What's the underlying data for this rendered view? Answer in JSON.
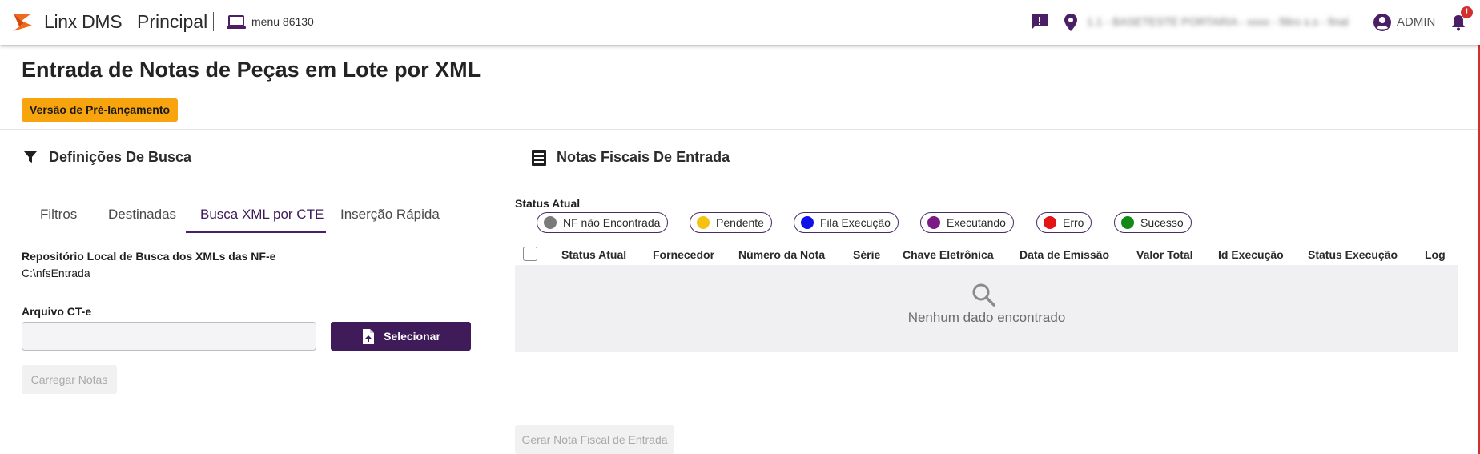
{
  "topbar": {
    "brand": "Linx DMS",
    "module": "Principal",
    "menu_label": "menu 86130",
    "location_text": "1.1 - BASETESTE PORTARIA - xxxx - filtro s.s - final",
    "user": "ADMIN",
    "notification_badge": "!",
    "colors": {
      "accent": "#4a1f66",
      "logo": "#f06a1e",
      "badge": "#d32f2f"
    }
  },
  "page": {
    "title": "Entrada de Notas de Peças em Lote por XML",
    "badge": "Versão de Pré-lançamento"
  },
  "left_panel": {
    "title": "Definições De Busca",
    "tabs": [
      {
        "label": "Filtros",
        "active": false
      },
      {
        "label": "Destinadas",
        "active": false
      },
      {
        "label": "Busca XML por CTE",
        "active": true
      },
      {
        "label": "Inserção Rápida",
        "active": false
      }
    ],
    "repo_label": "Repositório Local de Busca dos XMLs das NF-e",
    "repo_path": "C:\\nfsEntrada",
    "cte_label": "Arquivo CT-e",
    "cte_value": "",
    "select_button": "Selecionar",
    "load_button": "Carregar Notas"
  },
  "right_panel": {
    "title": "Notas Fiscais De Entrada",
    "status_label": "Status Atual",
    "status_chips": [
      {
        "label": "NF não Encontrada",
        "color": "#7a7a7a"
      },
      {
        "label": "Pendente",
        "color": "#f5c211"
      },
      {
        "label": "Fila Execução",
        "color": "#1010e8"
      },
      {
        "label": "Executando",
        "color": "#7b1a84"
      },
      {
        "label": "Erro",
        "color": "#e51515"
      },
      {
        "label": "Sucesso",
        "color": "#138a17"
      }
    ],
    "columns": [
      "Status Atual",
      "Fornecedor",
      "Número da Nota",
      "Série",
      "Chave Eletrônica",
      "Data de Emissão",
      "Valor Total",
      "Id Execução",
      "Status Execução",
      "Log"
    ],
    "empty_text": "Nenhum dado encontrado",
    "generate_button": "Gerar Nota Fiscal de Entrada"
  }
}
